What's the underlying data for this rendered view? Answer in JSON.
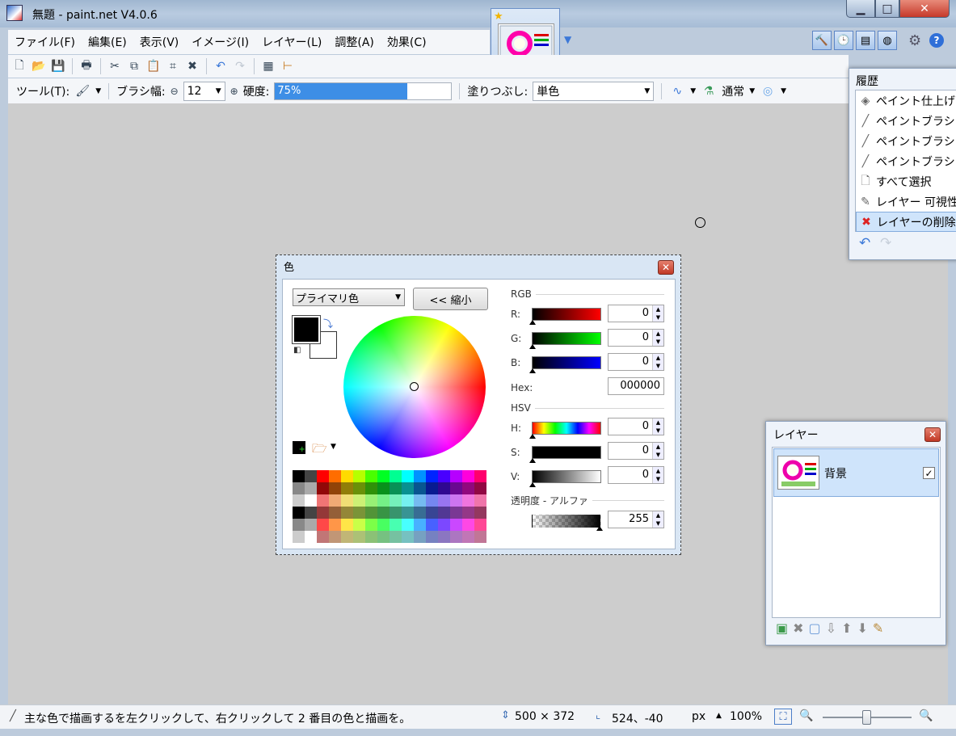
{
  "window": {
    "title": "無題 - paint.net V4.0.6",
    "min": "▁",
    "max": "□",
    "close": "✕"
  },
  "menu": [
    {
      "label": "ファイル(F)"
    },
    {
      "label": "編集(E)"
    },
    {
      "label": "表示(V)"
    },
    {
      "label": "イメージ(I)"
    },
    {
      "label": "レイヤー(L)"
    },
    {
      "label": "調整(A)"
    },
    {
      "label": "効果(C)"
    }
  ],
  "toolbar2": {
    "tool_label": "ツール(T):",
    "brush_width_label": "ブラシ幅:",
    "brush_width_value": "12",
    "hardness_label": "硬度:",
    "hardness_value": "75%",
    "hardness_fraction": 0.75,
    "fill_label": "塗りつぶし:",
    "fill_value": "単色",
    "blend_value": "通常"
  },
  "history": {
    "title": "履歴",
    "items": [
      {
        "label": "ペイント仕上げ",
        "icon": "bucket-icon"
      },
      {
        "label": "ペイントブラシ",
        "icon": "brush-icon"
      },
      {
        "label": "ペイントブラシ",
        "icon": "brush-icon"
      },
      {
        "label": "ペイントブラシ",
        "icon": "brush-icon"
      },
      {
        "label": "すべて選択",
        "icon": "page-icon"
      },
      {
        "label": "レイヤー 可視性",
        "icon": "layer-props-icon"
      },
      {
        "label": "レイヤーの削除",
        "icon": "delete-icon"
      }
    ]
  },
  "colors": {
    "title": "色",
    "mode": "プライマリ色",
    "shrink": "<< 縮小",
    "rgb_label": "RGB",
    "r_label": "R:",
    "r": "0",
    "g_label": "G:",
    "g": "0",
    "b_label": "B:",
    "b": "0",
    "hex_label": "Hex:",
    "hex": "000000",
    "hsv_label": "HSV",
    "h_label": "H:",
    "h": "0",
    "s_label": "S:",
    "s": "0",
    "v_label": "V:",
    "v": "0",
    "alpha_label": "透明度 - アルファ",
    "alpha": "255",
    "primary_color": "#000000",
    "secondary_color": "#ffffff"
  },
  "layers": {
    "title": "レイヤー",
    "layer_name": "背景",
    "visible_check": "✓"
  },
  "status": {
    "message": "主な色で描画するを左クリックして、右クリックして 2 番目の色と描画を。",
    "image_size": "500 × 372",
    "cursor": "524、-40",
    "unit": "px",
    "zoom": "100%"
  }
}
